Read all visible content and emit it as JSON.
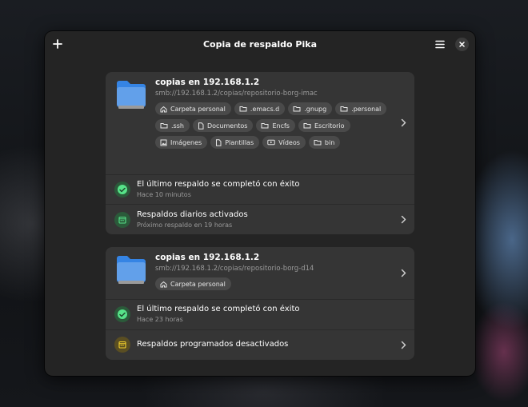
{
  "window": {
    "title": "Copia de respaldo Pika"
  },
  "repos": [
    {
      "title": "copias en 192.168.1.2",
      "url": "smb://192.168.1.2/copias/repositorio-borg-imac",
      "chips": [
        {
          "label": "Carpeta personal",
          "icon": "home-icon"
        },
        {
          "label": ".emacs.d",
          "icon": "folder-icon"
        },
        {
          "label": ".gnupg",
          "icon": "folder-icon"
        },
        {
          "label": ".personal",
          "icon": "folder-icon"
        },
        {
          "label": ".ssh",
          "icon": "folder-icon"
        },
        {
          "label": "Documentos",
          "icon": "document-icon"
        },
        {
          "label": "Encfs",
          "icon": "folder-icon"
        },
        {
          "label": "Escritorio",
          "icon": "folder-icon"
        },
        {
          "label": "Imágenes",
          "icon": "image-icon"
        },
        {
          "label": "Plantillas",
          "icon": "template-icon"
        },
        {
          "label": "Vídeos",
          "icon": "video-icon"
        },
        {
          "label": "bin",
          "icon": "folder-icon"
        }
      ],
      "status": {
        "title": "El último respaldo se completó con éxito",
        "subtitle": "Hace 10 minutos"
      },
      "schedule": {
        "title": "Respaldos diarios activados",
        "subtitle": "Próximo respaldo en 19 horas"
      }
    },
    {
      "title": "copias en 192.168.1.2",
      "url": "smb://192.168.1.2/copias/repositorio-borg-d14",
      "chips": [
        {
          "label": "Carpeta personal",
          "icon": "home-icon"
        }
      ],
      "status": {
        "title": "El último respaldo se completó con éxito",
        "subtitle": "Hace 23 horas"
      },
      "schedule": {
        "title": "Respaldos programados desactivados"
      }
    }
  ],
  "colors": {
    "window_bg": "#242424",
    "card_bg": "#353535",
    "chip_bg": "#4a4a4a",
    "folder_blue": "#62a0ea",
    "success_green": "#57e389",
    "warning_yellow": "#f6d32d"
  }
}
